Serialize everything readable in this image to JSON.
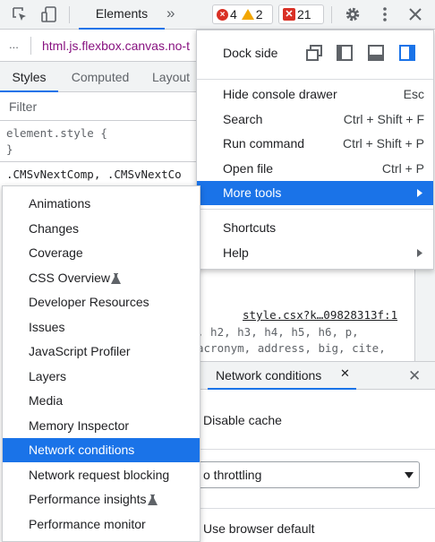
{
  "toolbar": {
    "elements_tab": "Elements",
    "more_tabs": "»",
    "errors_count": "4",
    "warnings_count": "2",
    "issues_count": "21"
  },
  "breadcrumb": {
    "dots": "...",
    "path": "html.js.flexbox.canvas.no-t"
  },
  "subtabs": [
    "Styles",
    "Computed",
    "Layout"
  ],
  "filter": {
    "placeholder": "Filter"
  },
  "styles": {
    "element_style": "element.style {",
    "close_brace": "}",
    "selector": ".CMSvNextComp, .CMSvNextCo"
  },
  "code": {
    "source_link": "style.csx?k…09828313f:1",
    "line1": ", h2, h3, h4, h5, h6, p,",
    "line2": "acronym, address, big, cite,"
  },
  "right_menu": {
    "dock_side": "Dock side",
    "items": [
      {
        "label": "Hide console drawer",
        "shortcut": "Esc"
      },
      {
        "label": "Search",
        "shortcut": "Ctrl + Shift + F"
      },
      {
        "label": "Run command",
        "shortcut": "Ctrl + Shift + P"
      },
      {
        "label": "Open file",
        "shortcut": "Ctrl + P"
      },
      {
        "label": "More tools",
        "shortcut": ""
      },
      {
        "label": "Shortcuts",
        "shortcut": ""
      },
      {
        "label": "Help",
        "shortcut": ""
      }
    ]
  },
  "left_menu": {
    "items": [
      "Animations",
      "Changes",
      "Coverage",
      "CSS Overview",
      "Developer Resources",
      "Issues",
      "JavaScript Profiler",
      "Layers",
      "Media",
      "Memory Inspector",
      "Network conditions",
      "Network request blocking",
      "Performance insights",
      "Performance monitor"
    ]
  },
  "drawer": {
    "tab_label": "Network conditions",
    "disable_cache": "Disable cache",
    "throttling_value": "o throttling",
    "user_agent": "Use browser default"
  },
  "colors": {
    "accent": "#1a73e8",
    "error": "#d93025",
    "warning": "#f2a600"
  }
}
